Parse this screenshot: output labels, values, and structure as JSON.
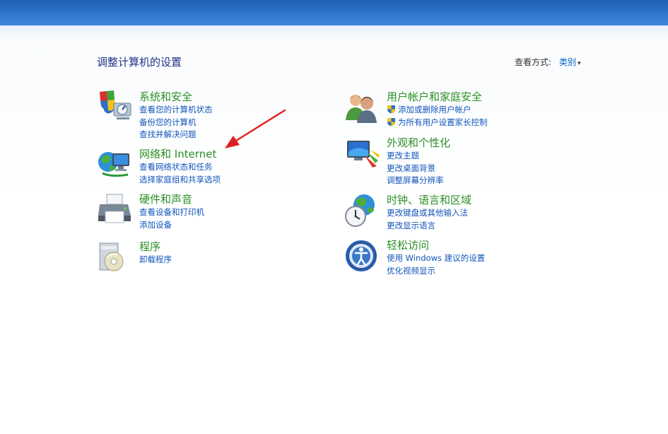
{
  "header": {
    "page_title": "调整计算机的设置",
    "view_by_label": "查看方式:",
    "view_by_value": "类别",
    "view_by_caret": "▾"
  },
  "left_categories": [
    {
      "icon": "shield-computer-icon",
      "title": "系统和安全",
      "links": [
        "查看您的计算机状态",
        "备份您的计算机",
        "查找并解决问题"
      ]
    },
    {
      "icon": "network-globe-icon",
      "title": "网络和 Internet",
      "links": [
        "查看网络状态和任务",
        "选择家庭组和共享选项"
      ]
    },
    {
      "icon": "printer-icon",
      "title": "硬件和声音",
      "links": [
        "查看设备和打印机",
        "添加设备"
      ]
    },
    {
      "icon": "programs-disc-icon",
      "title": "程序",
      "links": [
        "卸载程序"
      ]
    }
  ],
  "right_categories": [
    {
      "icon": "users-icon",
      "title": "用户帐户和家庭安全",
      "links": [
        "添加或删除用户帐户",
        "为所有用户设置家长控制"
      ]
    },
    {
      "icon": "appearance-monitor-icon",
      "title": "外观和个性化",
      "links": [
        "更改主题",
        "更改桌面背景",
        "调整屏幕分辨率"
      ]
    },
    {
      "icon": "clock-globe-icon",
      "title": "时钟、语言和区域",
      "links": [
        "更改键盘或其他输入法",
        "更改显示语言"
      ]
    },
    {
      "icon": "ease-of-access-icon",
      "title": "轻松访问",
      "links": [
        "使用 Windows 建议的设置",
        "优化视频显示"
      ]
    }
  ],
  "colors": {
    "title_green": "#2b8f25",
    "link_blue": "#1155bb",
    "heading_blue": "#1e3287",
    "annotation_red": "#e02020"
  }
}
